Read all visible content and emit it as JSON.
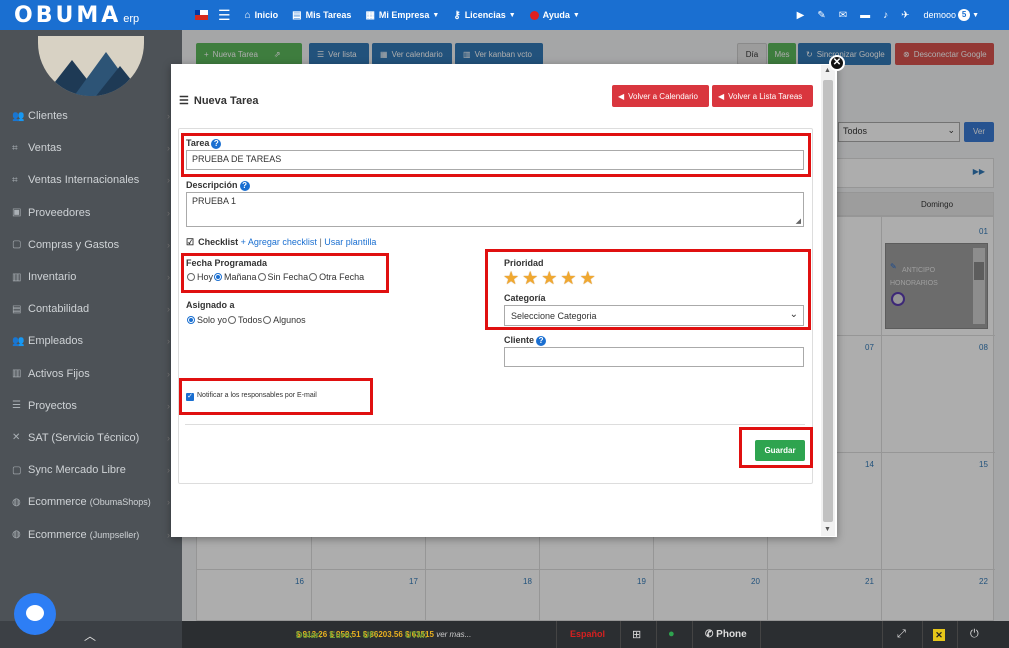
{
  "brand": {
    "main": "OBUMA",
    "sub": "erp"
  },
  "nav": {
    "items": [
      {
        "icon": "⌂",
        "label": "Inicio",
        "caret": false
      },
      {
        "icon": "▤",
        "label": "Mis Tareas",
        "caret": false
      },
      {
        "icon": "▦",
        "label": "Mi Empresa",
        "caret": true
      },
      {
        "icon": "⚷",
        "label": "Licencias",
        "caret": true
      },
      {
        "icon": "",
        "label": "Ayuda",
        "caret": true
      }
    ],
    "user": "demooo",
    "user_badge": "5"
  },
  "sidebar": {
    "items": [
      {
        "label": "Clientes",
        "suffix": ""
      },
      {
        "label": "Ventas",
        "suffix": ""
      },
      {
        "label": "Ventas Internacionales",
        "suffix": ""
      },
      {
        "label": "Proveedores",
        "suffix": ""
      },
      {
        "label": "Compras y Gastos",
        "suffix": ""
      },
      {
        "label": "Inventario",
        "suffix": ""
      },
      {
        "label": "Contabilidad",
        "suffix": ""
      },
      {
        "label": "Empleados",
        "suffix": ""
      },
      {
        "label": "Activos Fijos",
        "suffix": ""
      },
      {
        "label": "Proyectos",
        "suffix": ""
      },
      {
        "label": "SAT (Servicio Técnico)",
        "suffix": ""
      },
      {
        "label": "Sync Mercado Libre",
        "suffix": ""
      },
      {
        "label": "Ecommerce",
        "suffix": "(ObumaShops)"
      },
      {
        "label": "Ecommerce",
        "suffix": "(Jumpseller)"
      }
    ]
  },
  "background": {
    "buttons": {
      "nueva_tarea": "Nueva Tarea",
      "ver_lista": "Ver lista",
      "ver_calendario": "Ver calendario",
      "ver_kanban": "Ver kanban vcto",
      "dia": "Día",
      "mes": "Mes",
      "sincronizar": "Sincronizar Google",
      "desconectar": "Desconectar Google",
      "ver": "Ver"
    },
    "filter_value": "Todos",
    "day_header": "Domingo",
    "event_text": "ANTICIPO HONORARIOS",
    "day_numbers": [
      "01",
      "07",
      "08",
      "14",
      "15",
      "16",
      "17",
      "18",
      "19",
      "20",
      "21",
      "22"
    ]
  },
  "footer": {
    "rates": [
      {
        "label": "Dolar:",
        "value": "$ 913.26"
      },
      {
        "label": "Euro:",
        "value": "$ 959.51"
      },
      {
        "label": "UF:",
        "value": "$ 36203.56"
      },
      {
        "label": "UTM:",
        "value": "$ 63515"
      }
    ],
    "more": "ver mas...",
    "language": "Español",
    "phone": "Phone"
  },
  "modal": {
    "title": "Nueva Tarea",
    "back_calendar": "Volver a Calendario",
    "back_list": "Volver a Lista Tareas",
    "tarea_label": "Tarea",
    "tarea_value": "PRUEBA DE TAREAS",
    "descripcion_label": "Descripción",
    "descripcion_value": "PRUEBA 1",
    "checklist_label": "Checklist",
    "add_checklist": "+ Agregar checklist",
    "sep": "|",
    "use_template": "Usar plantilla",
    "fecha_label": "Fecha Programada",
    "fecha_options": [
      {
        "label": "Hoy",
        "checked": false
      },
      {
        "label": "Mañana",
        "checked": true
      },
      {
        "label": "Sin Fecha",
        "checked": false
      },
      {
        "label": "Otra Fecha",
        "checked": false
      }
    ],
    "asignado_label": "Asignado a",
    "asignado_options": [
      {
        "label": "Solo yo",
        "checked": true
      },
      {
        "label": "Todos",
        "checked": false
      },
      {
        "label": "Algunos",
        "checked": false
      }
    ],
    "prioridad_label": "Prioridad",
    "prioridad_stars": 5,
    "categoria_label": "Categoría",
    "categoria_value": "Seleccione Categoria",
    "cliente_label": "Cliente",
    "cliente_value": "",
    "notify_label": "Notificar a los responsables por E-mail",
    "notify_checked": true,
    "save_label": "Guardar"
  },
  "colors": {
    "navbar": "#1a6fd1",
    "sidebar": "#4d5257",
    "save_button": "#2ea44f",
    "back_button": "#d9363e",
    "highlight": "#e01010"
  }
}
